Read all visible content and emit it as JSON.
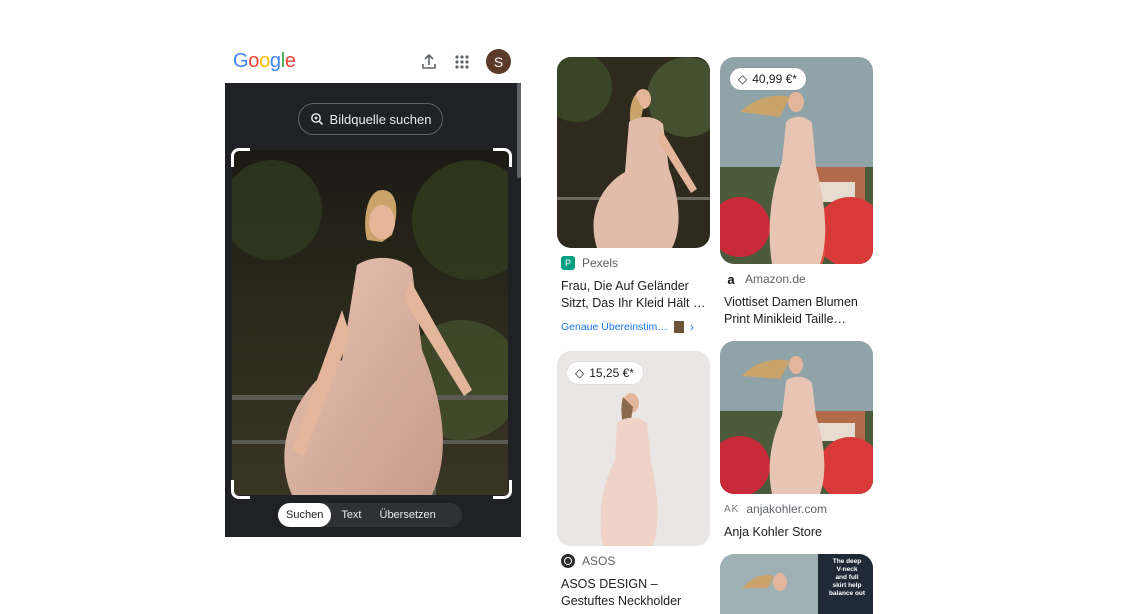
{
  "header": {
    "logo": [
      "G",
      "o",
      "o",
      "g",
      "l",
      "e"
    ],
    "logo_colors": [
      "#4285F4",
      "#EA4335",
      "#FBBC05",
      "#4285F4",
      "#34A853",
      "#EA4335"
    ],
    "avatar_initial": "S",
    "icons": [
      "upload-icon",
      "apps-grid-icon"
    ]
  },
  "lens": {
    "source_button": "Bildquelle suchen",
    "modes": [
      "Suchen",
      "Text",
      "Übersetzen"
    ],
    "active_mode": "Suchen"
  },
  "results": [
    {
      "source": "Pexels",
      "title_line1": "Frau, Die Auf Geländer",
      "title_line2": "Sitzt, Das Ihr Kleid Hält …",
      "match": "Genaue Übereinstim…"
    },
    {
      "price": "40,99 €*",
      "source": "Amazon.de",
      "title_line1": "Viottiset Damen Blumen",
      "title_line2": "Print Minikleid Taille…"
    },
    {
      "price": "15,25 €*",
      "source": "ASOS",
      "title_line1": "ASOS DESIGN –",
      "title_line2": "Gestuftes Neckholder"
    },
    {
      "source_logo": "AK",
      "source": "anjakohler.com",
      "title_line1": "Anja Kohler Store"
    },
    {
      "overlay_text": [
        "The deep",
        "V-neck",
        "and full",
        "skirt help",
        "balance out"
      ]
    }
  ],
  "colors": {
    "lens_bg": "#202124",
    "accent_blue": "#1a73e8",
    "avatar_bg": "#5c3a2a"
  }
}
